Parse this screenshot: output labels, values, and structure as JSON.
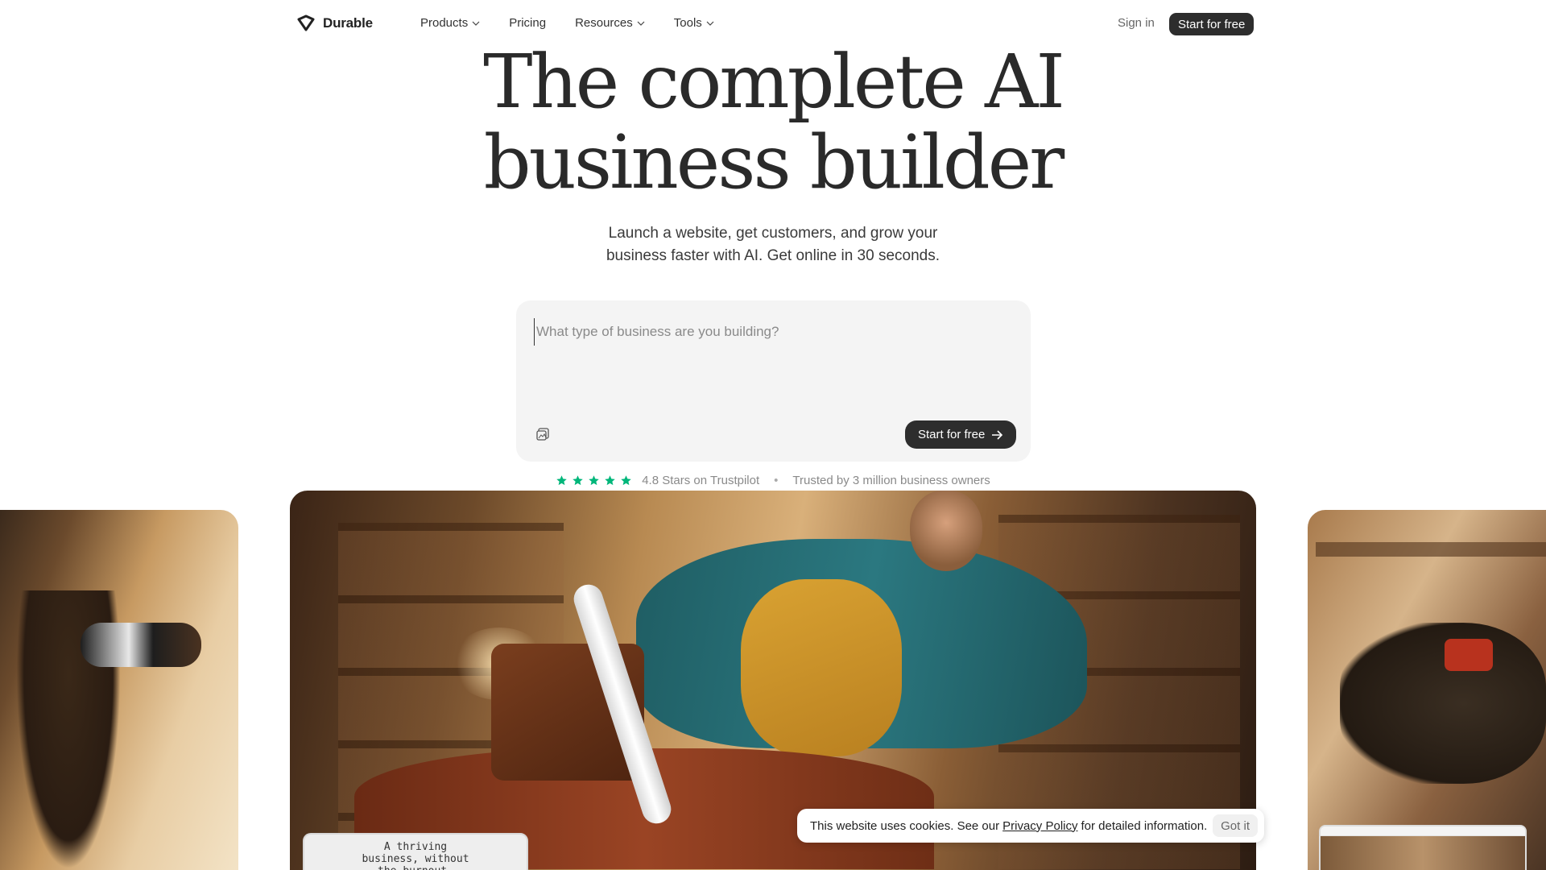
{
  "nav": {
    "brand": "Durable",
    "items": [
      {
        "label": "Products",
        "dropdown": true
      },
      {
        "label": "Pricing",
        "dropdown": false
      },
      {
        "label": "Resources",
        "dropdown": true
      },
      {
        "label": "Tools",
        "dropdown": true
      }
    ],
    "signin_label": "Sign in",
    "cta_label": "Start for free"
  },
  "hero": {
    "title_line1": "The complete AI",
    "title_line2": "business builder",
    "subtitle_line1": "Launch a website, get customers, and grow your",
    "subtitle_line2": "business faster with AI. Get online in 30 seconds."
  },
  "prompt": {
    "placeholder": "What type of business are you building?",
    "value": "",
    "cta_label": "Start for free"
  },
  "rating": {
    "stars": 5,
    "text": "4.8 Stars on Trustpilot",
    "separator": "•",
    "trust_text": "Trusted by 3 million business owners",
    "star_color": "#00b67a"
  },
  "gallery": {
    "caption": "A thriving\nbusiness, without\nthe burnout."
  },
  "cookie": {
    "text_before": "This website uses cookies. See our",
    "link_label": "Privacy Policy",
    "text_after": "for detailed information.",
    "button_label": "Got it"
  },
  "colors": {
    "dark_button": "#2d2d2d",
    "prompt_bg": "#f4f4f4"
  }
}
